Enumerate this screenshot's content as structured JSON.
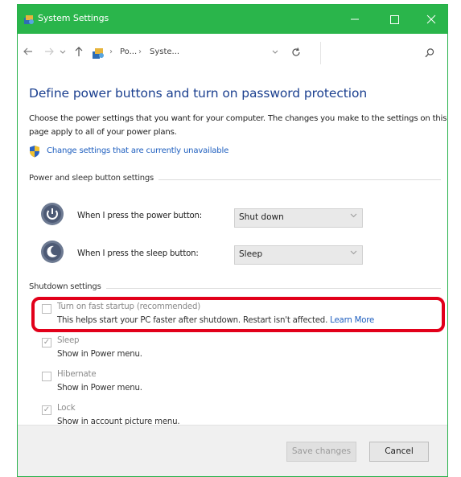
{
  "window": {
    "title": "System Settings",
    "accent_color": "#2ab54b"
  },
  "addressbar": {
    "back_icon": "arrow-left-icon",
    "forward_icon": "arrow-right-icon",
    "up_icon": "arrow-up-icon",
    "crumbs": [
      "Po...",
      "Syste..."
    ],
    "separator": "›",
    "refresh_icon": "refresh-icon",
    "search_icon": "search-icon"
  },
  "page": {
    "title": "Define power buttons and turn on password protection",
    "description": "Choose the power settings that you want for your computer. The changes you make to the settings on this page apply to all of your power plans.",
    "change_link": "Change settings that are currently unavailable"
  },
  "power_section": {
    "label": "Power and sleep button settings",
    "rows": [
      {
        "label": "When I press the power button:",
        "value": "Shut down",
        "icon": "power-button-icon"
      },
      {
        "label": "When I press the sleep button:",
        "value": "Sleep",
        "icon": "sleep-button-icon"
      }
    ]
  },
  "shutdown_section": {
    "label": "Shutdown settings",
    "items": [
      {
        "title": "Turn on fast startup (recommended)",
        "subtitle": "This helps start your PC faster after shutdown. Restart isn't affected.",
        "link": "Learn More",
        "checked": false
      },
      {
        "title": "Sleep",
        "subtitle": "Show in Power menu.",
        "checked": true
      },
      {
        "title": "Hibernate",
        "subtitle": "Show in Power menu.",
        "checked": false
      },
      {
        "title": "Lock",
        "subtitle": "Show in account picture menu.",
        "checked": true
      }
    ]
  },
  "footer": {
    "save_label": "Save changes",
    "cancel_label": "Cancel"
  },
  "colors": {
    "highlight": "#e2001a",
    "link": "#1f5fbf",
    "heading": "#1a3f8f"
  }
}
